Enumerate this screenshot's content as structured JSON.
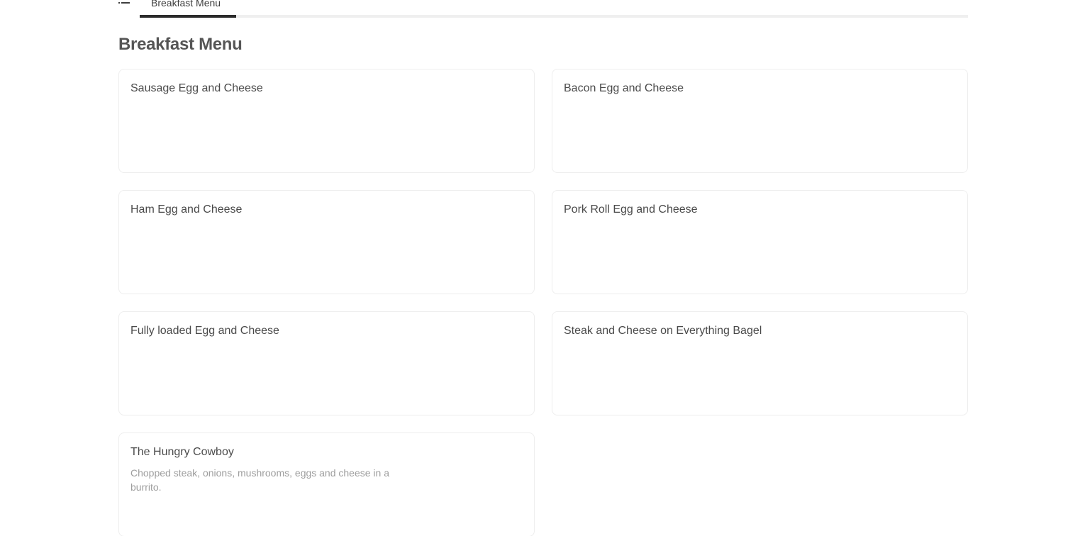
{
  "nav": {
    "menu_icon": "list-menu-icon",
    "active_tab_label": "Breakfast Menu"
  },
  "section": {
    "title": "Breakfast Menu"
  },
  "items": [
    {
      "name": "Sausage Egg and Cheese",
      "description": ""
    },
    {
      "name": "Bacon Egg and Cheese",
      "description": ""
    },
    {
      "name": "Ham Egg and Cheese",
      "description": ""
    },
    {
      "name": "Pork Roll Egg and Cheese",
      "description": ""
    },
    {
      "name": "Fully loaded Egg and Cheese",
      "description": ""
    },
    {
      "name": "Steak and Cheese on Everything Bagel",
      "description": ""
    },
    {
      "name": "The Hungry Cowboy",
      "description": "Chopped steak, onions, mushrooms, eggs and cheese in a burrito."
    }
  ]
}
